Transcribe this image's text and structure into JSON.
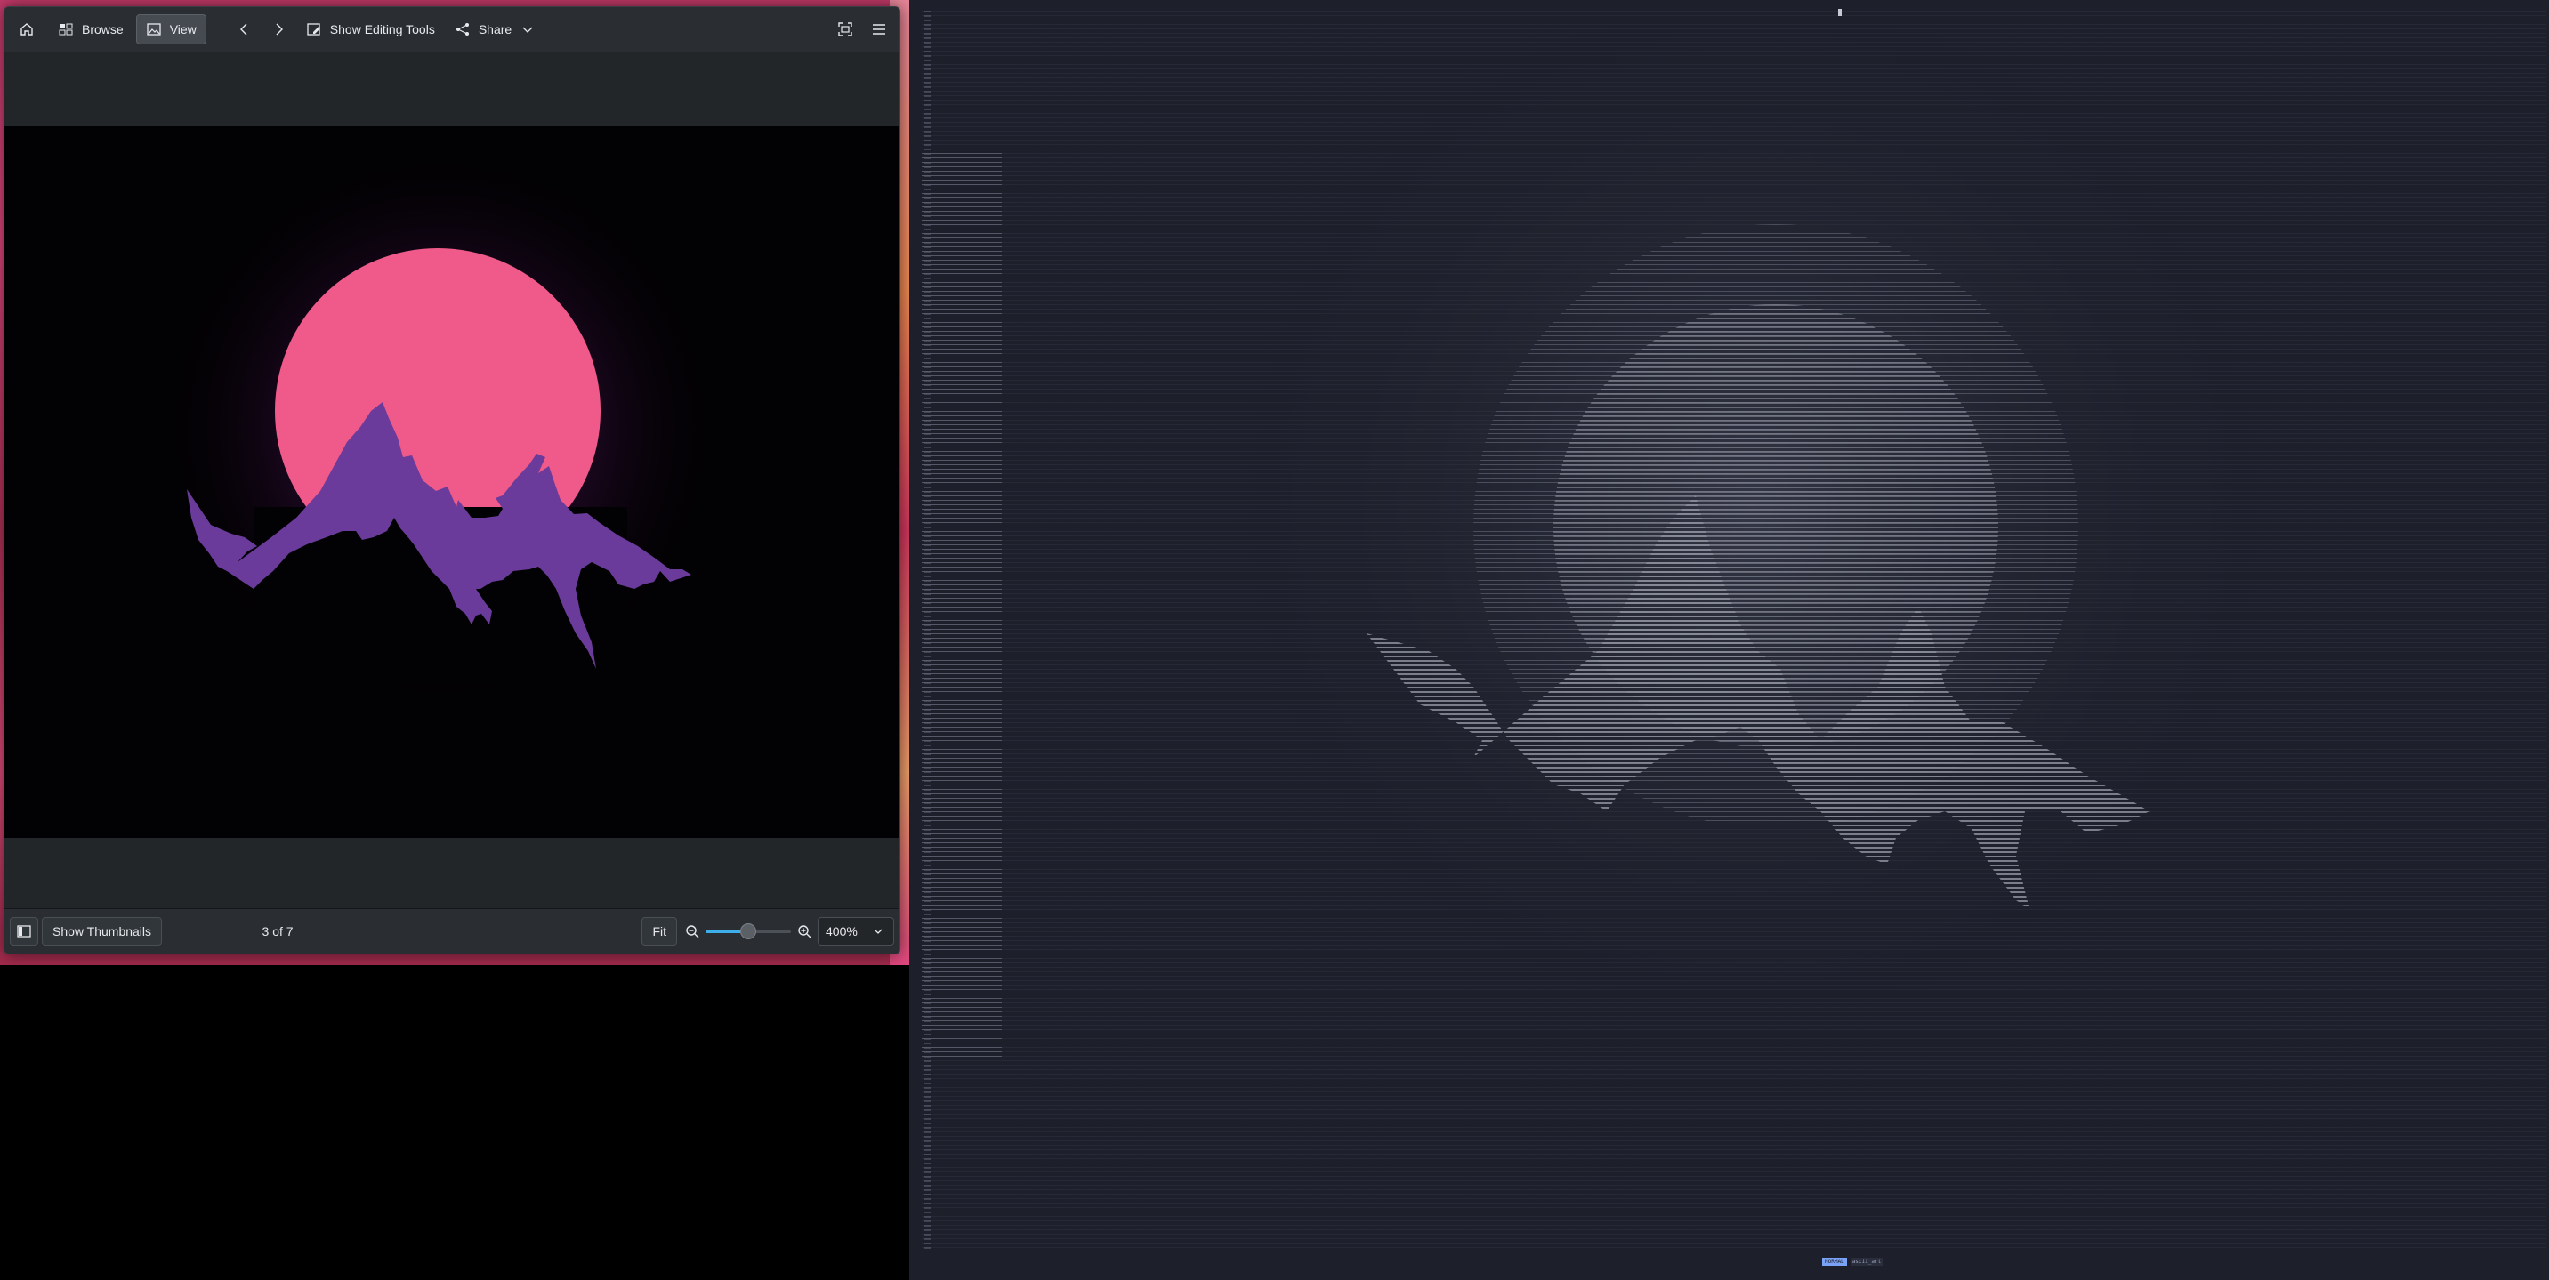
{
  "viewer": {
    "toolbar": {
      "browse_label": "Browse",
      "view_label": "View",
      "editing_tools_label": "Show Editing Tools",
      "share_label": "Share"
    },
    "image": {
      "description_icon": "mountain-sunset-image",
      "colors": {
        "sun": "#ef5a8a",
        "mountain": "#6a3b9a",
        "glow": "#3a1340",
        "background": "#020103"
      }
    },
    "status": {
      "thumbnails_label": "Show Thumbnails",
      "position_text": "3 of 7",
      "fit_label": "Fit",
      "zoom_value": "400%",
      "zoom_slider_fraction": 0.5
    }
  },
  "terminal": {
    "background": "#1d1f2b",
    "mode_label": "NORMAL",
    "file_label": "ascii_art"
  }
}
